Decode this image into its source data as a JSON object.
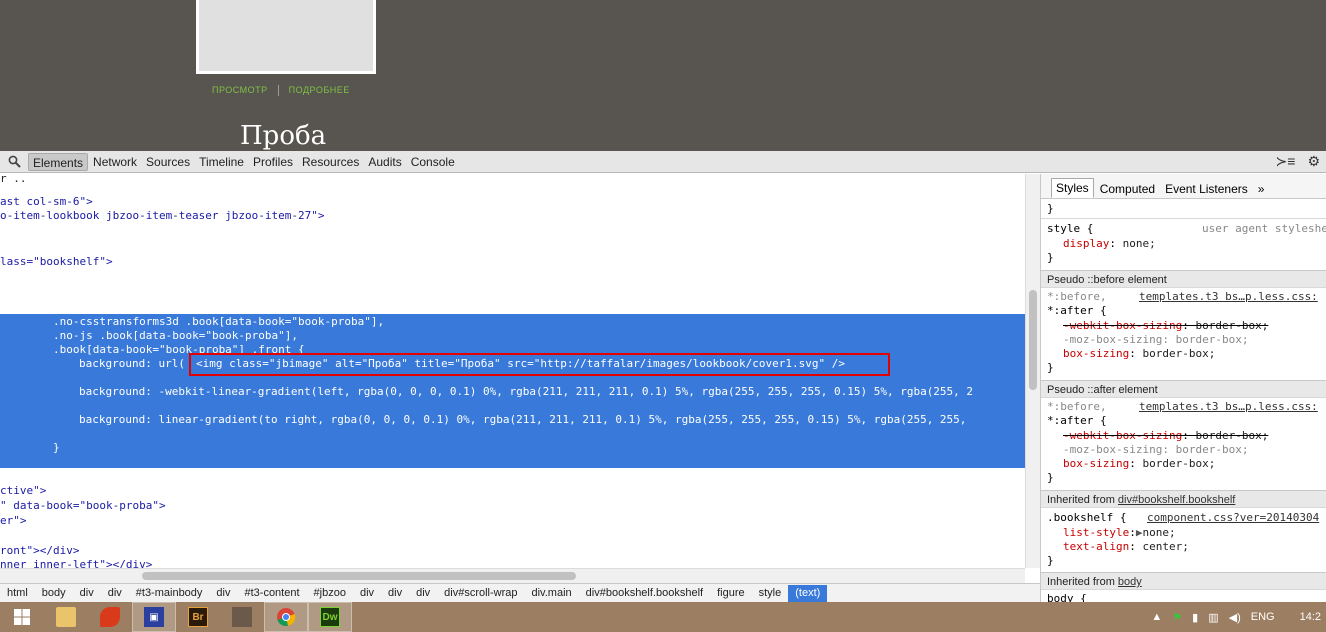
{
  "preview": {
    "links": [
      "ПРОСМОТР",
      "ПОДРОБНЕЕ"
    ],
    "title": "Проба"
  },
  "toolbar": {
    "tabs": [
      "Elements",
      "Network",
      "Sources",
      "Timeline",
      "Profiles",
      "Resources",
      "Audits",
      "Console"
    ],
    "active_tab": "Elements"
  },
  "elements": {
    "lines_top": [
      "ast col-sm-6\">",
      "o-item-lookbook jbzoo-item-teaser jbzoo-item-27\">",
      "lass=\"bookshelf\">"
    ],
    "selected_lines": [
      ".no-csstransforms3d .book[data-book=\"book-proba\"],",
      ".no-js .book[data-book=\"book-proba\"],",
      ".book[data-book=\"book-proba\"] .front {",
      "background: url(",
      "<img class=\"jbimage\" alt=\"Проба\" title=\"Проба\" src=\"http://taffalar/images/lookbook/cover1.svg\" />",
      "background: -webkit-linear-gradient(left, rgba(0, 0, 0, 0.1) 0%, rgba(211, 211, 211, 0.1) 5%, rgba(255, 255, 255, 0.15) 5%, rgba(255, 2",
      "background: linear-gradient(to right, rgba(0, 0, 0, 0.1) 0%, rgba(211, 211, 211, 0.1) 5%, rgba(255, 255, 255, 0.15) 5%, rgba(255, 255,",
      "}"
    ],
    "lines_bottom": [
      "ctive\">",
      "\" data-book=\"book-proba\">",
      "er\">",
      "ront\"></div>",
      "nner inner-left\"></div>"
    ]
  },
  "breadcrumb": [
    "html",
    "body",
    "div",
    "div",
    "#t3-mainbody",
    "div",
    "#t3-content",
    "#jbzoo",
    "div",
    "div",
    "div",
    "div#scroll-wrap",
    "div.main",
    "div#bookshelf.bookshelf",
    "figure",
    "style",
    "(text)"
  ],
  "sidebar": {
    "tabs": [
      "Styles",
      "Computed",
      "Event Listeners",
      "»"
    ],
    "style_rule": {
      "selector": "style {",
      "origin": "user agent styleshe",
      "prop": "display",
      "value": "none;"
    },
    "before": {
      "header": "Pseudo ::before element",
      "selector1": "*:before,",
      "source": "templates.t3 bs…p.less.css:",
      "selector2": "*:after {",
      "props": [
        {
          "name": "-webkit-box-sizing",
          "value": "border-box;",
          "struck": true
        },
        {
          "name": "-moz-box-sizing",
          "value": "border-box;",
          "dim": true
        },
        {
          "name": "box-sizing",
          "value": "border-box;"
        }
      ]
    },
    "after": {
      "header": "Pseudo ::after element",
      "selector1": "*:before,",
      "source": "templates.t3 bs…p.less.css:",
      "selector2": "*:after {",
      "props": [
        {
          "name": "-webkit-box-sizing",
          "value": "border-box;",
          "struck": true
        },
        {
          "name": "-moz-box-sizing",
          "value": "border-box;",
          "dim": true
        },
        {
          "name": "box-sizing",
          "value": "border-box;"
        }
      ]
    },
    "inherited1": {
      "prefix": "Inherited from ",
      "link": "div#bookshelf.bookshelf",
      "selector": ".bookshelf {",
      "source": "component.css?ver=20140304",
      "props": [
        {
          "name": "list-style",
          "value": "none;"
        },
        {
          "name": "text-align",
          "value": "center;"
        }
      ]
    },
    "inherited2": {
      "prefix": "Inherited from ",
      "link": "body",
      "selector": "body {"
    }
  },
  "taskbar": {
    "lang": "ENG",
    "time": "14:2"
  },
  "colors": {
    "selection": "#3879d9",
    "highlight": "#e30000",
    "taskbar": "#9c7e62"
  }
}
